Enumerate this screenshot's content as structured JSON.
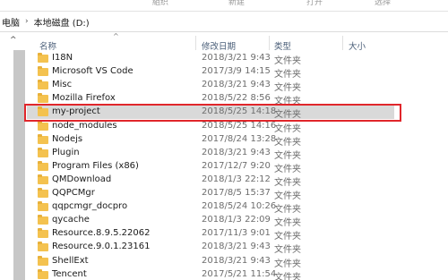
{
  "ribbon": {
    "labels": [
      "組织",
      "新建",
      "打开",
      "选择"
    ]
  },
  "breadcrumb": {
    "root": "电脑",
    "separator": "›",
    "current": "本地磁盘 (D:)"
  },
  "columns": {
    "name": "名称",
    "date": "修改日期",
    "type": "类型",
    "size": "大小"
  },
  "files": [
    {
      "name": "I18N",
      "date": "2018/3/21 9:43",
      "type": "文件夹"
    },
    {
      "name": "Microsoft VS Code",
      "date": "2017/3/9 14:15",
      "type": "文件夹"
    },
    {
      "name": "Misc",
      "date": "2018/3/21 9:43",
      "type": "文件夹"
    },
    {
      "name": "Mozilla Firefox",
      "date": "2018/5/22 8:56",
      "type": "文件夹"
    },
    {
      "name": "my-project",
      "date": "2018/5/25 14:18",
      "type": "文件夹",
      "selected": true
    },
    {
      "name": "node_modules",
      "date": "2018/5/25 14:16",
      "type": "文件夹"
    },
    {
      "name": "Nodejs",
      "date": "2017/8/24 13:28",
      "type": "文件夹"
    },
    {
      "name": "Plugin",
      "date": "2018/3/21 9:43",
      "type": "文件夹"
    },
    {
      "name": "Program Files (x86)",
      "date": "2017/12/7 9:20",
      "type": "文件夹"
    },
    {
      "name": "QMDownload",
      "date": "2018/1/3 22:12",
      "type": "文件夹"
    },
    {
      "name": "QQPCMgr",
      "date": "2017/8/5 15:37",
      "type": "文件夹"
    },
    {
      "name": "qqpcmgr_docpro",
      "date": "2018/5/24 10:26",
      "type": "文件夹"
    },
    {
      "name": "qycache",
      "date": "2018/1/3 22:09",
      "type": "文件夹"
    },
    {
      "name": "Resource.8.9.5.22062",
      "date": "2017/11/3 9:01",
      "type": "文件夹"
    },
    {
      "name": "Resource.9.0.1.23161",
      "date": "2018/3/21 9:43",
      "type": "文件夹"
    },
    {
      "name": "ShellExt",
      "date": "2018/3/21 9:43",
      "type": "文件夹"
    },
    {
      "name": "Tencent",
      "date": "2017/5/21 11:54",
      "type": "文件夹"
    }
  ],
  "colors": {
    "folder": "#f4c24f",
    "selection": "#d9d9d9",
    "highlight_border": "#e0262b",
    "header_text": "#4c607a"
  },
  "icons": {
    "folder": "folder-icon",
    "scroll_up": "chevron-up-icon",
    "sort": "sort-arrow-icon"
  }
}
